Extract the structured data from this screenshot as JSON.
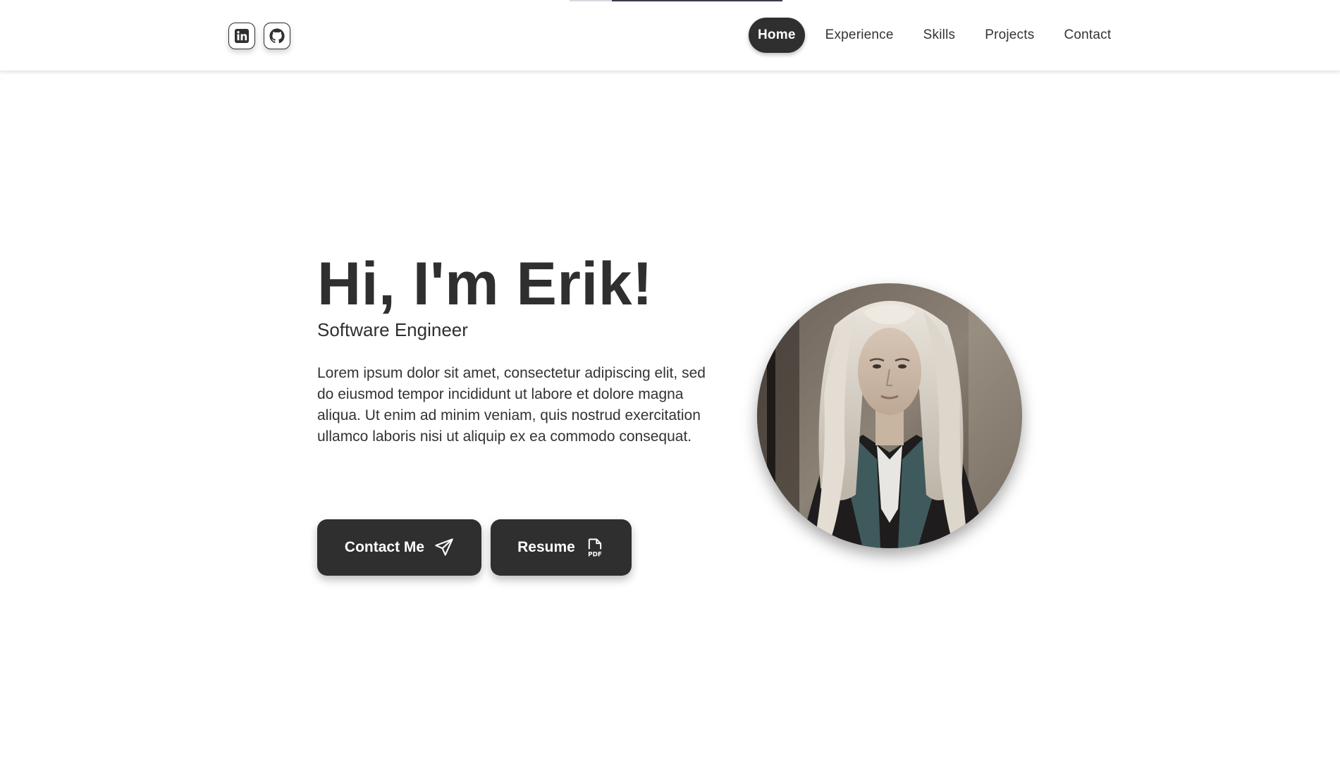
{
  "header": {
    "socials": [
      {
        "icon": "linkedin-icon"
      },
      {
        "icon": "github-icon"
      }
    ],
    "nav": [
      {
        "label": "Home",
        "active": true
      },
      {
        "label": "Experience",
        "active": false
      },
      {
        "label": "Skills",
        "active": false
      },
      {
        "label": "Projects",
        "active": false
      },
      {
        "label": "Contact",
        "active": false
      }
    ]
  },
  "hero": {
    "title": "Hi, I'm Erik!",
    "subtitle": "Software Engineer",
    "description": "Lorem ipsum dolor sit amet, consectetur adipiscing elit, sed do eiusmod tempor incididunt ut labore et dolore magna aliqua. Ut enim ad minim veniam, quis nostrud exercitation ullamco laboris nisi ut aliquip ex ea commodo consequat.",
    "buttons": {
      "contact_label": "Contact Me",
      "contact_icon": "paper-plane-icon",
      "resume_label": "Resume",
      "resume_icon": "pdf-file-icon"
    }
  },
  "colors": {
    "primary": "#2f2f2f",
    "background": "#ffffff",
    "on_primary": "#ffffff"
  }
}
